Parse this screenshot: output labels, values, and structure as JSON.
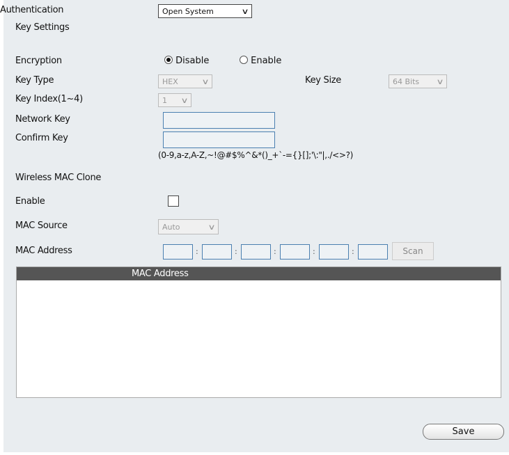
{
  "authentication": {
    "label": "Authentication",
    "value": "Open System"
  },
  "key_settings": {
    "title": "Key Settings",
    "encryption": {
      "label": "Encryption",
      "options": [
        "Disable",
        "Enable"
      ],
      "selected": "Disable"
    },
    "key_type": {
      "label": "Key Type",
      "value": "HEX"
    },
    "key_size": {
      "label": "Key Size",
      "value": "64 Bits"
    },
    "key_index": {
      "label": "Key Index(1~4)",
      "value": "1"
    },
    "network_key": {
      "label": "Network Key",
      "value": ""
    },
    "confirm_key": {
      "label": "Confirm Key",
      "value": ""
    },
    "hint": "(0-9,a-z,A-Z,~!@#$%^&*()_+`-={}[];'\\:\"|,./<>?)"
  },
  "mac_clone": {
    "title": "Wireless MAC Clone",
    "enable": {
      "label": "Enable",
      "checked": false
    },
    "mac_source": {
      "label": "MAC Source",
      "value": "Auto"
    },
    "mac_address": {
      "label": "MAC Address",
      "octets": [
        "",
        "",
        "",
        "",
        "",
        ""
      ],
      "separator": ":",
      "scan_label": "Scan"
    },
    "table": {
      "header": "MAC Address",
      "rows": []
    }
  },
  "save_label": "Save"
}
